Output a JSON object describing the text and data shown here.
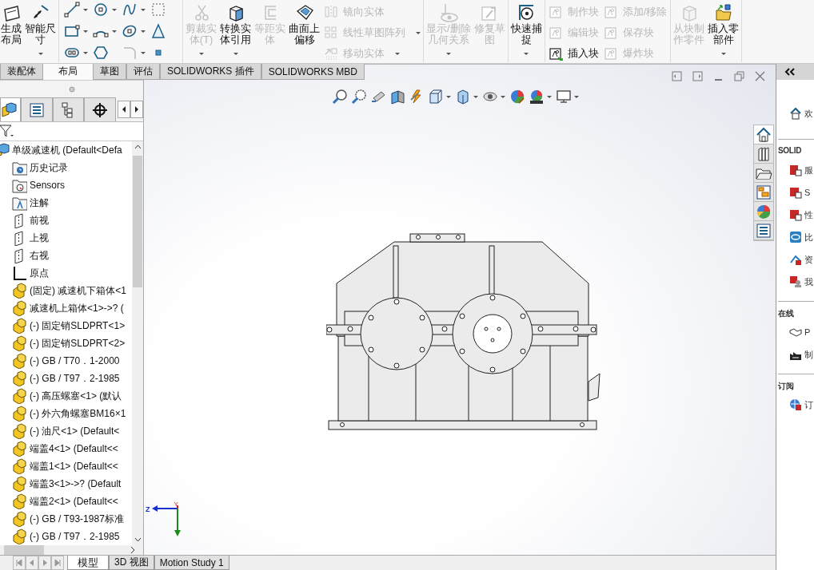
{
  "ribbon": {
    "groups": [
      {
        "items": [
          {
            "kind": "large",
            "label": [
              "生成",
              "布局"
            ],
            "disabled": false,
            "dropdown": false
          },
          {
            "kind": "large",
            "label": [
              "智能尺",
              "寸"
            ],
            "disabled": false,
            "dropdown": true
          }
        ]
      },
      {
        "items": [
          {
            "kind": "large",
            "label": [
              "剪裁实",
              "体(T)"
            ],
            "disabled": true,
            "dropdown": true
          },
          {
            "kind": "large",
            "label": [
              "转换实",
              "体引用"
            ],
            "disabled": false,
            "dropdown": true
          },
          {
            "kind": "large",
            "label": [
              "等距实",
              "体"
            ],
            "disabled": true,
            "dropdown": false
          },
          {
            "kind": "large",
            "label": [
              "曲面上",
              "偏移"
            ],
            "disabled": false,
            "dropdown": false
          },
          {
            "kind": "stack",
            "items": [
              {
                "label": "镜向实体",
                "disabled": true,
                "dropdown": false
              },
              {
                "label": "线性草图阵列",
                "disabled": true,
                "dropdown": true
              },
              {
                "label": "移动实体",
                "disabled": true,
                "dropdown": true
              }
            ]
          }
        ]
      },
      {
        "items": [
          {
            "kind": "large",
            "label": [
              "显示/删除",
              "几何关系"
            ],
            "disabled": true,
            "dropdown": true
          },
          {
            "kind": "large",
            "label": [
              "修复草",
              "图"
            ],
            "disabled": true,
            "dropdown": false
          }
        ]
      },
      {
        "items": [
          {
            "kind": "large",
            "label": [
              "快速捕",
              "捉"
            ],
            "disabled": false,
            "dropdown": true
          }
        ]
      },
      {
        "items": [
          {
            "kind": "stack",
            "items": [
              {
                "label": "制作块",
                "disabled": true,
                "dropdown": false
              },
              {
                "label": "编辑块",
                "disabled": true,
                "dropdown": false
              },
              {
                "label": "插入块",
                "disabled": false,
                "dropdown": false
              }
            ]
          },
          {
            "kind": "stack",
            "items": [
              {
                "label": "添加/移除",
                "disabled": true,
                "dropdown": false
              },
              {
                "label": "保存块",
                "disabled": true,
                "dropdown": false
              },
              {
                "label": "爆炸块",
                "disabled": true,
                "dropdown": false
              }
            ]
          }
        ]
      },
      {
        "items": [
          {
            "kind": "large",
            "label": [
              "从块制",
              "作零件"
            ],
            "disabled": true,
            "dropdown": false
          },
          {
            "kind": "large",
            "label": [
              "插入零",
              "部件"
            ],
            "disabled": false,
            "dropdown": true
          }
        ]
      }
    ]
  },
  "tabs": [
    {
      "label": "装配体",
      "selected": false
    },
    {
      "label": "布局",
      "selected": true
    },
    {
      "label": "草图",
      "selected": false
    },
    {
      "label": "评估",
      "selected": false
    },
    {
      "label": "SOLIDWORKS 插件",
      "selected": false
    },
    {
      "label": "SOLIDWORKS MBD",
      "selected": false
    }
  ],
  "tree": {
    "kind": "assembly",
    "label": "单级减速机 (Default<Defa",
    "children": [
      {
        "kind": "history",
        "label": "历史记录"
      },
      {
        "kind": "sensors",
        "label": "Sensors"
      },
      {
        "kind": "annotations",
        "label": "注解"
      },
      {
        "kind": "plane",
        "label": "前视"
      },
      {
        "kind": "plane",
        "label": "上视"
      },
      {
        "kind": "plane",
        "label": "右视"
      },
      {
        "kind": "origin",
        "label": "原点"
      },
      {
        "kind": "part",
        "label": "(固定) 减速机下箱体<1"
      },
      {
        "kind": "part",
        "label": "减速机上箱体<1>->? ("
      },
      {
        "kind": "part",
        "label": "(-) 固定销SLDPRT<1>"
      },
      {
        "kind": "part",
        "label": "(-) 固定销SLDPRT<2>"
      },
      {
        "kind": "part",
        "label": "(-) GB / T70．1-2000"
      },
      {
        "kind": "part",
        "label": "(-) GB / T97．2-1985"
      },
      {
        "kind": "part",
        "label": "(-) 高压螺塞<1> (默认"
      },
      {
        "kind": "part",
        "label": "(-) 外六角螺塞BM16×1"
      },
      {
        "kind": "part",
        "label": "(-) 油尺<1> (Default<"
      },
      {
        "kind": "part",
        "label": "端盖4<1> (Default<<"
      },
      {
        "kind": "part",
        "label": "端盖1<1> (Default<<"
      },
      {
        "kind": "part",
        "label": "端盖3<1>->? (Default"
      },
      {
        "kind": "part",
        "label": "端盖2<1> (Default<<"
      },
      {
        "kind": "part",
        "label": "(-) GB / T93-1987标准"
      },
      {
        "kind": "part",
        "label": "(-) GB / T97．2-1985"
      }
    ]
  },
  "panel_tabs": [
    {
      "selected": true
    },
    {
      "selected": false
    },
    {
      "selected": false
    },
    {
      "selected": false
    }
  ],
  "side_tabs": [
    {
      "selected": true
    },
    {
      "selected": false
    },
    {
      "selected": false
    },
    {
      "selected": false
    },
    {
      "selected": false
    },
    {
      "selected": false
    }
  ],
  "triad": {
    "labels": [
      "Z",
      "Y"
    ]
  },
  "bottom_tabs": [
    {
      "label": "模型",
      "selected": true
    },
    {
      "label": "3D 视图",
      "selected": false
    },
    {
      "label": "Motion Study 1",
      "selected": false
    }
  ],
  "task_pane": {
    "items": [
      {
        "kind": "link",
        "text": "欢"
      },
      {
        "kind": "heading",
        "text": "SOLID"
      },
      {
        "kind": "link",
        "text": "服"
      },
      {
        "kind": "link",
        "text": "S"
      },
      {
        "kind": "link",
        "text": "性"
      },
      {
        "kind": "link",
        "text": "比"
      },
      {
        "kind": "link",
        "text": "资"
      },
      {
        "kind": "link",
        "text": "我"
      },
      {
        "kind": "heading",
        "text": "在线"
      },
      {
        "kind": "link",
        "text": "P"
      },
      {
        "kind": "link",
        "text": "制"
      },
      {
        "kind": "heading",
        "text": "订阅"
      },
      {
        "kind": "link",
        "text": "订"
      }
    ]
  }
}
